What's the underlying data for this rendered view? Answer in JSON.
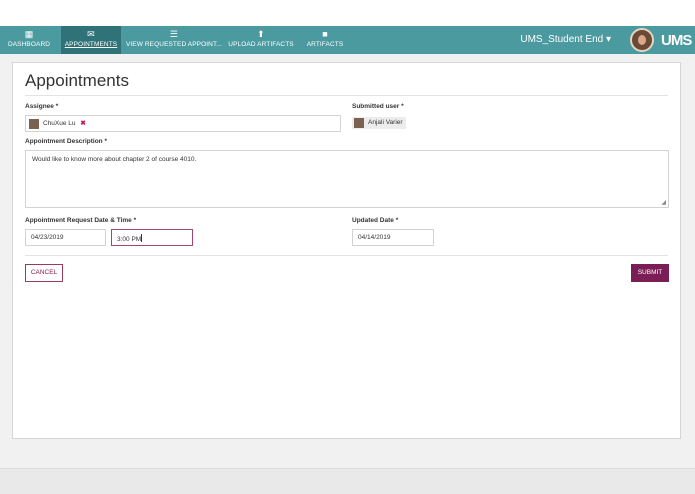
{
  "nav": {
    "items": [
      {
        "label": "DASHBOARD",
        "icon": "dashboard-icon"
      },
      {
        "label": "APPOINTMENTS",
        "icon": "envelope-icon"
      },
      {
        "label": "VIEW REQUESTED APPOINT...",
        "icon": "list-icon"
      },
      {
        "label": "UPLOAD ARTIFACTS",
        "icon": "upload-icon"
      },
      {
        "label": "ARTIFACTS",
        "icon": "folder-icon"
      }
    ],
    "user_menu": "UMS_Student End ▾",
    "logo": "UMS"
  },
  "page": {
    "title": "Appointments"
  },
  "form": {
    "assignee_label": "Assignee *",
    "assignee_value": "ChuXue Lu",
    "submitted_user_label": "Submitted user *",
    "submitted_user_value": "Anjali Varier",
    "description_label": "Appointment Description *",
    "description_value": "Would like to know more about chapter 2 of course 4010.",
    "request_datetime_label": "Appointment Request Date & Time *",
    "request_date": "04/23/2019",
    "request_time": "3:00 PM",
    "updated_date_label": "Updated Date *",
    "updated_date": "04/14/2019"
  },
  "actions": {
    "cancel": "CANCEL",
    "submit": "SUBMIT"
  },
  "colors": {
    "navbar": "#4b9aa0",
    "nav_active": "#2f7379",
    "primary_button": "#7b1e56"
  }
}
